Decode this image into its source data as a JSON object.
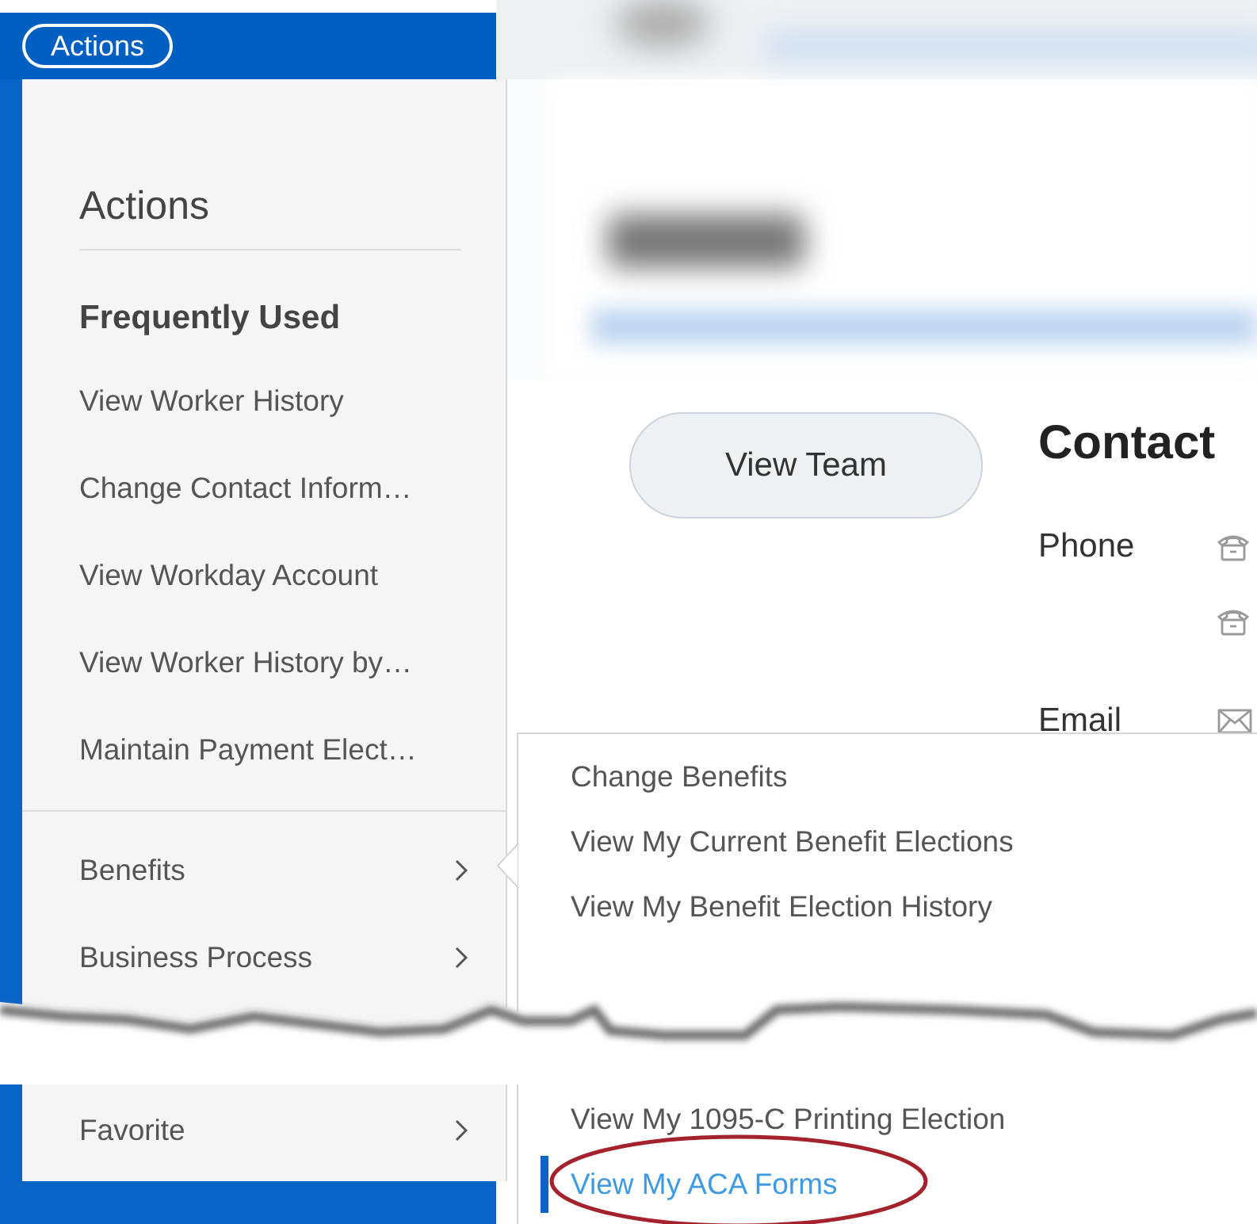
{
  "top_bar": {
    "actions_button": "Actions"
  },
  "profile": {
    "button": "View Team",
    "contact": {
      "heading": "Contact",
      "phone_label": "Phone",
      "email_label": "Email"
    }
  },
  "menu": {
    "title": "Actions",
    "frequently_used": {
      "heading": "Frequently Used",
      "items": [
        "View Worker History",
        "Change Contact Inform…",
        "View Workday Account",
        "View Worker History by…",
        "Maintain Payment Elect…"
      ]
    },
    "categories_upper": [
      {
        "label": "Benefits"
      },
      {
        "label": "Business Process"
      }
    ],
    "categories_lower": [
      {
        "label": "Favorite"
      }
    ]
  },
  "submenu": {
    "items_upper": [
      {
        "label": "Change Benefits",
        "selected": false
      },
      {
        "label": "View My Current Benefit Elections",
        "selected": false
      },
      {
        "label": "View My Benefit Election History",
        "selected": false
      }
    ],
    "items_lower": [
      {
        "label": "View My 1095-C Printing Election",
        "selected": false
      },
      {
        "label": "View My ACA Forms",
        "selected": true
      }
    ]
  }
}
